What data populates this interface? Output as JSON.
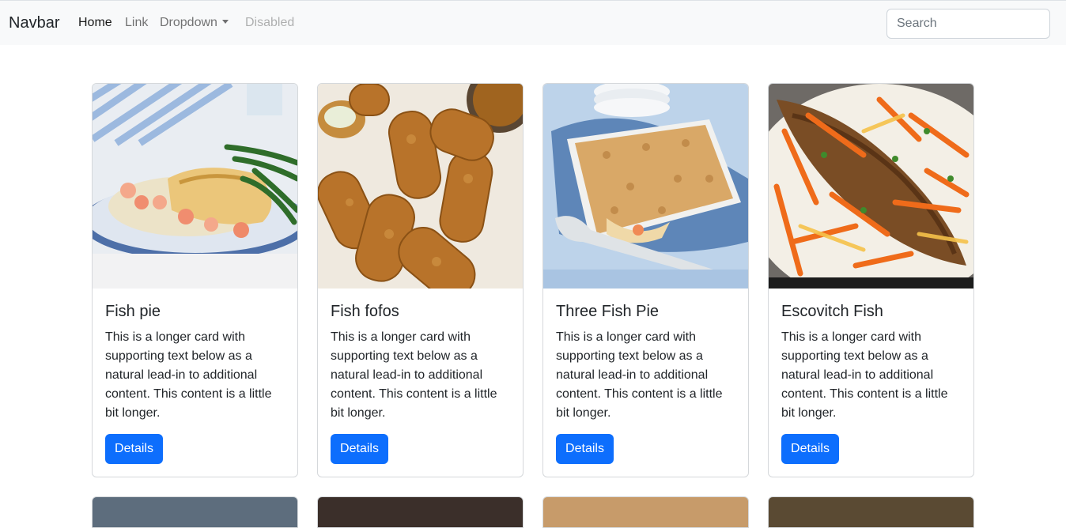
{
  "navbar": {
    "brand": "Navbar",
    "links": [
      {
        "label": "Home"
      },
      {
        "label": "Link"
      },
      {
        "label": "Dropdown"
      },
      {
        "label": "Disabled"
      }
    ],
    "search_placeholder": "Search"
  },
  "cards": [
    {
      "title": "Fish pie",
      "text": "This is a longer card with supporting text below as a natural lead-in to additional content. This content is a little bit longer.",
      "button": "Details"
    },
    {
      "title": "Fish fofos",
      "text": "This is a longer card with supporting text below as a natural lead-in to additional content. This content is a little bit longer.",
      "button": "Details"
    },
    {
      "title": "Three Fish Pie",
      "text": "This is a longer card with supporting text below as a natural lead-in to additional content. This content is a little bit longer.",
      "button": "Details"
    },
    {
      "title": "Escovitch Fish",
      "text": "This is a longer card with supporting text below as a natural lead-in to additional content. This content is a little bit longer.",
      "button": "Details"
    }
  ],
  "colors": {
    "primary": "#0d6efd",
    "navbar_bg": "#f8f9fa"
  }
}
